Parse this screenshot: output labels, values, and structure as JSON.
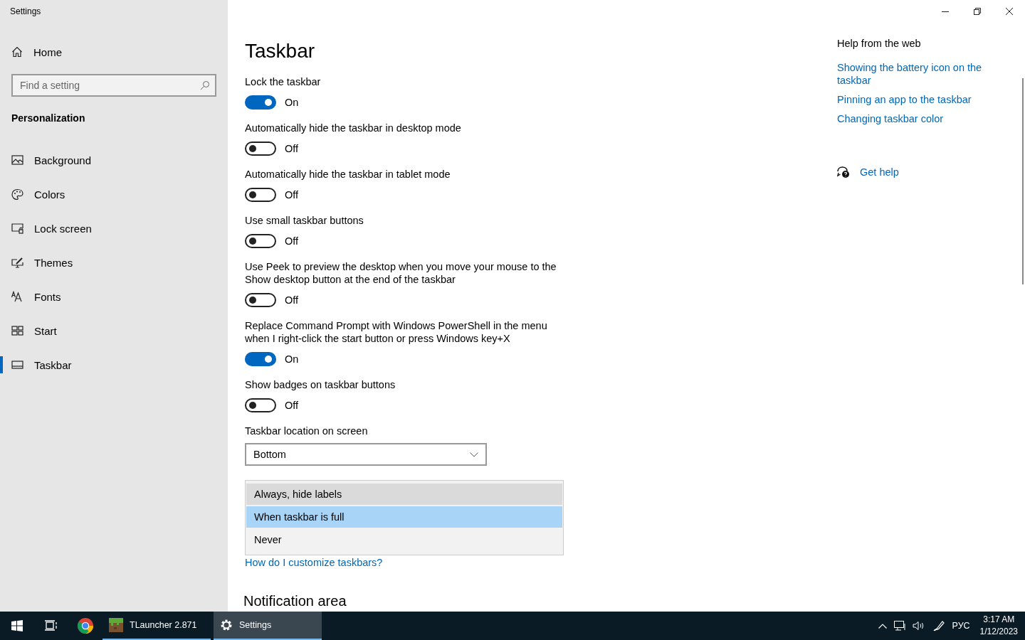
{
  "window": {
    "title": "Settings"
  },
  "sidebar": {
    "home": "Home",
    "search": {
      "placeholder": "Find a setting"
    },
    "section": "Personalization",
    "items": [
      {
        "label": "Background",
        "selected": false
      },
      {
        "label": "Colors",
        "selected": false
      },
      {
        "label": "Lock screen",
        "selected": false
      },
      {
        "label": "Themes",
        "selected": false
      },
      {
        "label": "Fonts",
        "selected": false
      },
      {
        "label": "Start",
        "selected": false
      },
      {
        "label": "Taskbar",
        "selected": true
      }
    ]
  },
  "page": {
    "title": "Taskbar",
    "settings": [
      {
        "label": "Lock the taskbar",
        "on": true,
        "state_text": "On"
      },
      {
        "label": "Automatically hide the taskbar in desktop mode",
        "on": false,
        "state_text": "Off"
      },
      {
        "label": "Automatically hide the taskbar in tablet mode",
        "on": false,
        "state_text": "Off"
      },
      {
        "label": "Use small taskbar buttons",
        "on": false,
        "state_text": "Off"
      },
      {
        "label": "Use Peek to preview the desktop when you move your mouse to the Show desktop button at the end of the taskbar",
        "on": false,
        "state_text": "Off"
      },
      {
        "label": "Replace Command Prompt with Windows PowerShell in the menu when I right-click the start button or press Windows key+X",
        "on": true,
        "state_text": "On"
      },
      {
        "label": "Show badges on taskbar buttons",
        "on": false,
        "state_text": "Off"
      }
    ],
    "location": {
      "label": "Taskbar location on screen",
      "value": "Bottom"
    },
    "combine_options": [
      {
        "label": "Always, hide labels",
        "selected": false,
        "hovered": true
      },
      {
        "label": "When taskbar is full",
        "selected": true,
        "hovered": false
      },
      {
        "label": "Never",
        "selected": false,
        "hovered": false
      }
    ],
    "link": "How do I customize taskbars?",
    "section": "Notification area"
  },
  "help": {
    "heading": "Help from the web",
    "links": [
      "Showing the battery icon on the taskbar",
      "Pinning an app to the taskbar",
      "Changing taskbar color"
    ],
    "get_help": "Get help"
  },
  "taskbar": {
    "apps": [
      {
        "label": "TLauncher 2.871",
        "active": false
      },
      {
        "label": "Settings",
        "active": true
      }
    ],
    "language": "РУС",
    "time": "3:17 AM",
    "date": "1/12/2023"
  }
}
